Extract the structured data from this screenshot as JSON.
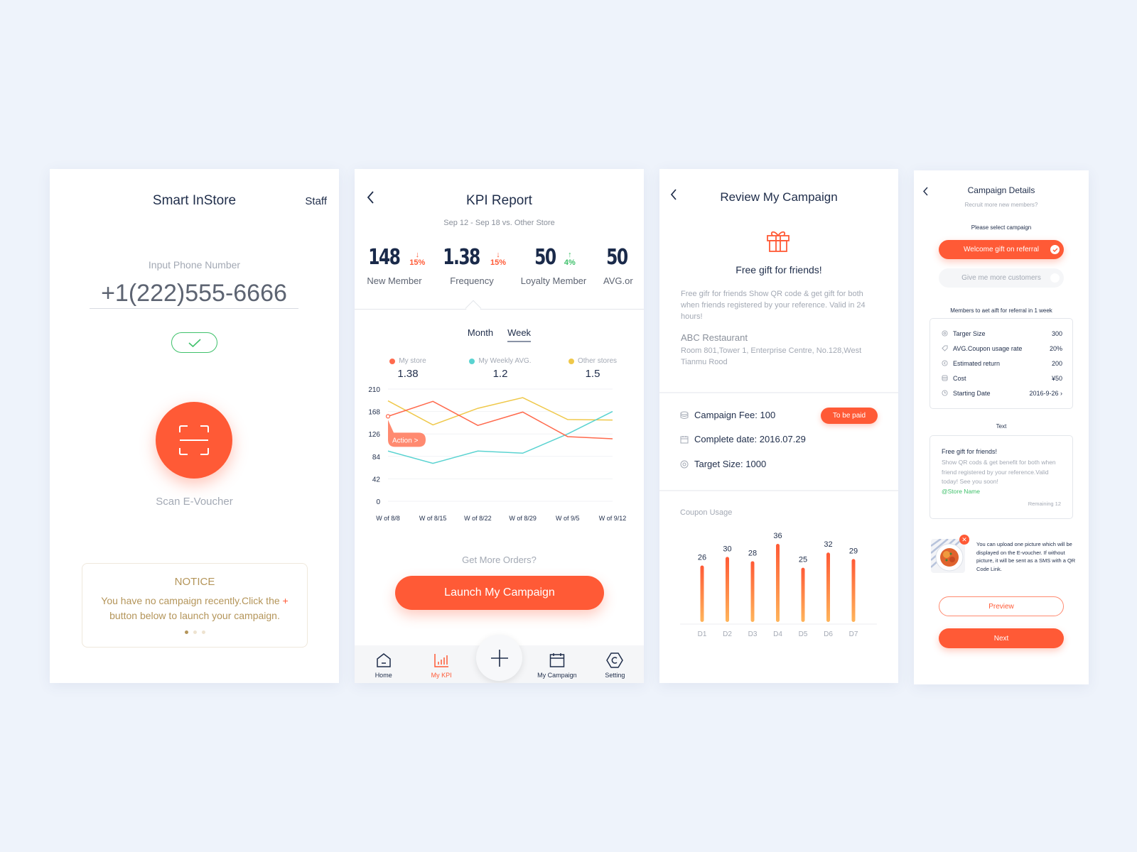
{
  "colors": {
    "accent": "#ff5a36",
    "success": "#3fc16b",
    "notice": "#b4955a",
    "my_store": "#ff6a4d",
    "weekly_avg": "#5ad3d1",
    "other_stores": "#efc84a"
  },
  "screen1": {
    "title": "Smart InStore",
    "staff_label": "Staff",
    "phone_label": "Input Phone Number",
    "phone_value": "+1(222)555-6666",
    "confirm_icon": "check-icon",
    "scan_icon": "scan-icon",
    "scan_label": "Scan E-Voucher",
    "notice": {
      "title": "NOTICE",
      "text_before": "You have no campaign recently.Click the ",
      "plus": "+",
      "text_after": " button below to launch your campaign.",
      "page_count": 3,
      "active_page": 1
    }
  },
  "screen2": {
    "title": "KPI Report",
    "subtitle": "Sep 12 - Sep 18  vs. Other Store",
    "kpis": [
      {
        "value": "148",
        "change": "15%",
        "direction": "down",
        "label": "New Member"
      },
      {
        "value": "1.38",
        "change": "15%",
        "direction": "down",
        "label": "Frequency"
      },
      {
        "value": "50",
        "change": "4%",
        "direction": "up",
        "label": "Loyalty Member"
      },
      {
        "value": "50",
        "change": "",
        "direction": "",
        "label": "AVG.or"
      }
    ],
    "tabs": [
      {
        "label": "Month",
        "active": false
      },
      {
        "label": "Week",
        "active": true
      }
    ],
    "legend": [
      {
        "name": "My store",
        "value": "1.38"
      },
      {
        "name": "My Weekly AVG.",
        "value": "1.2"
      },
      {
        "name": "Other stores",
        "value": "1.5"
      }
    ],
    "action_label": "Action >",
    "more_orders": "Get More Orders?",
    "launch_button": "Launch My Campaign",
    "tabbar": [
      {
        "label": "Home",
        "icon": "home-icon",
        "active": false
      },
      {
        "label": "My KPI",
        "icon": "bar-chart-icon",
        "active": true
      },
      {
        "label": "My Campaign",
        "icon": "calendar-icon",
        "active": false
      },
      {
        "label": "Setting",
        "icon": "settings-icon",
        "active": false
      }
    ],
    "fab_icon": "plus-icon"
  },
  "screen3": {
    "title": "Review My Campaign",
    "gift_icon": "gift-icon",
    "heading": "Free gift for friends!",
    "description": "Free gifr for friends Show QR code & get gift for both when friends registered by your reference. Valid in 24 hours!",
    "restaurant": "ABC Restaurant",
    "address": "Room 801,Tower 1, Enterprise Centre, No.128,West Tianmu Rood",
    "details": [
      {
        "icon": "coins-icon",
        "text": "Campaign Fee: 100"
      },
      {
        "icon": "calendar-icon",
        "text": "Complete date: 2016.07.29"
      },
      {
        "icon": "target-icon",
        "text": "Target Size: 1000"
      }
    ],
    "status_badge": "To be paid",
    "coupon_title": "Coupon Usage"
  },
  "screen4": {
    "title": "Campaign Details",
    "subtitle": "Recruit more new members?",
    "select_label": "Please select campaign",
    "options": [
      {
        "label": "Welcome gift on referral",
        "selected": true
      },
      {
        "label": "Give me more customers",
        "selected": false
      }
    ],
    "members_label": "Members to aet aift for referral in 1 week",
    "rows": [
      {
        "icon": "target-icon",
        "label": "Targer Size",
        "value": "300"
      },
      {
        "icon": "tag-icon",
        "label": "AVG.Coupon usage rate",
        "value": "20%"
      },
      {
        "icon": "return-icon",
        "label": "Estimated return",
        "value": "200"
      },
      {
        "icon": "coins-icon",
        "label": "Cost",
        "value": "¥50"
      },
      {
        "icon": "clock-icon",
        "label": "Starting Date",
        "value": "2016-9-26 ›"
      }
    ],
    "text_label": "Text",
    "message": {
      "title": "Free gift for friends!",
      "body": "Show QR cods & get benefit for both when friend registered by your reference.Valid today! See you soon!",
      "store_tag": "@Store Name",
      "remaining": "Remaining 12"
    },
    "upload_text": "You can upload one picture which will be displayed on the E-voucher. If without picture, it will be sent as a SMS with a QR Code Link.",
    "preview_button": "Preview",
    "next_button": "Next"
  },
  "chart_data": [
    {
      "type": "line",
      "title": "KPI Report - Week",
      "categories": [
        "W of 8/8",
        "W of 8/15",
        "W of 8/22",
        "W of 8/29",
        "W of 9/5",
        "W of 9/12"
      ],
      "yticks": [
        0,
        42,
        84,
        126,
        168,
        210
      ],
      "ylim": [
        0,
        210
      ],
      "grid": true,
      "series": [
        {
          "name": "My store",
          "values": [
            159,
            187,
            142,
            167,
            121,
            117
          ]
        },
        {
          "name": "My Weekly AVG.",
          "values": [
            94,
            71,
            94,
            90,
            126,
            168
          ]
        },
        {
          "name": "Other stores",
          "values": [
            188,
            143,
            174,
            194,
            153,
            152
          ]
        }
      ],
      "xlabel": "",
      "ylabel": ""
    },
    {
      "type": "bar",
      "title": "Coupon Usage",
      "categories": [
        "D1",
        "D2",
        "D3",
        "D4",
        "D5",
        "D6",
        "D7"
      ],
      "values": [
        26,
        30,
        28,
        36,
        25,
        32,
        29
      ],
      "xlabel": "",
      "ylabel": ""
    }
  ]
}
